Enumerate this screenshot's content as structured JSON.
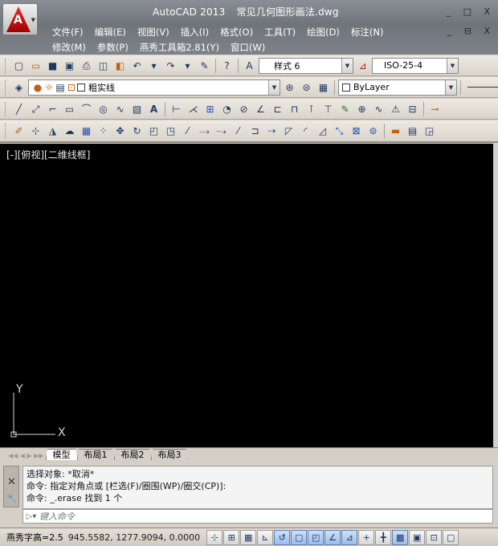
{
  "window": {
    "app_name": "AutoCAD 2013",
    "file_name": "常见几何图形画法.dwg",
    "controls": "_ □ X",
    "doc_controls": "_ ⊟ X"
  },
  "menu": {
    "row1": [
      "文件(F)",
      "编辑(E)",
      "视图(V)",
      "插入(I)",
      "格式(O)",
      "工具(T)",
      "绘图(D)",
      "标注(N)"
    ],
    "row2": [
      "修改(M)",
      "参数(P)",
      "燕秀工具箱2.81(Y)",
      "窗口(W)"
    ]
  },
  "toolbar1": {
    "text_style": "样式 6",
    "dim_style": "ISO-25-4"
  },
  "toolbar2": {
    "layer": "粗实线",
    "color": "ByLayer"
  },
  "drawing": {
    "viewport_label": "[-][俯视][二维线框]",
    "ucs_y_label": "Y",
    "ucs_x_label": "X",
    "background": "#000000"
  },
  "layout_tabs": [
    "模型",
    "布局1",
    "布局2",
    "布局3"
  ],
  "command": {
    "history": [
      "选择对象: *取消*",
      "命令: 指定对角点或 [栏选(F)/圈围(WP)/圈交(CP)]:",
      "命令: _.erase 找到 1 个"
    ],
    "input_placeholder": "键入命令"
  },
  "status": {
    "text_height": "燕秀字高=2.5",
    "coords": "945.5582,   1277.9094,  0.0000"
  }
}
